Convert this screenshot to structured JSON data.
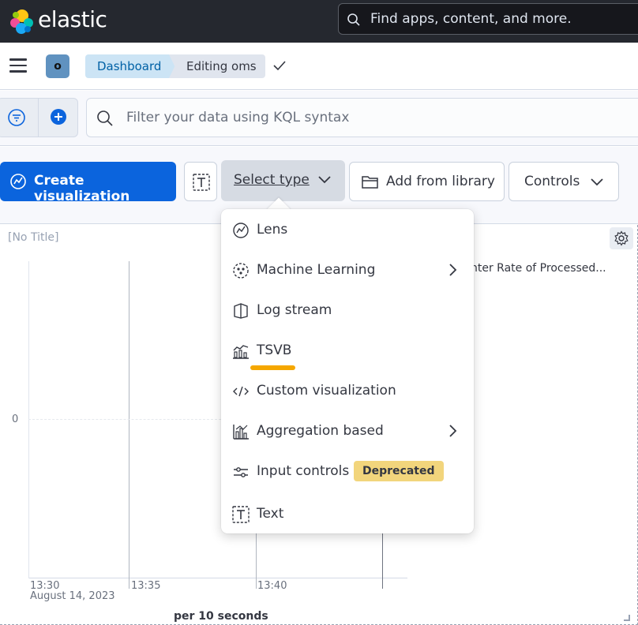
{
  "header": {
    "brand": "elastic",
    "search_placeholder": "Find apps, content, and more."
  },
  "breadcrumbs": {
    "space_initial": "o",
    "items": [
      "Dashboard",
      "Editing oms"
    ]
  },
  "query_bar": {
    "placeholder": "Filter your data using KQL syntax"
  },
  "toolbar": {
    "create_label": "Create visualization",
    "select_type_label": "Select type",
    "library_label": "Add from library",
    "controls_label": "Controls"
  },
  "panel": {
    "title": "[No Title]",
    "legend": "nter Rate of Processed...",
    "y_zero": "0",
    "x_ticks": [
      "13:30",
      "13:35",
      "13:40"
    ],
    "x_date": "August 14, 2023",
    "x_axis_title": "per 10 seconds"
  },
  "menu": {
    "items": [
      {
        "label": "Lens",
        "icon": "lens-icon"
      },
      {
        "label": "Machine Learning",
        "icon": "machine-learning-icon"
      },
      {
        "label": "Log stream",
        "icon": "log-stream-icon"
      },
      {
        "label": "TSVB",
        "icon": "tsvb-icon"
      },
      {
        "label": "Custom visualization",
        "icon": "code-icon"
      },
      {
        "label": "Aggregation based",
        "icon": "aggregation-icon"
      },
      {
        "label": "Input controls",
        "icon": "input-controls-icon"
      },
      {
        "label": "Text",
        "icon": "text-icon"
      }
    ],
    "badge": "Deprecated"
  },
  "colors": {
    "header_bg": "#25282f",
    "primary": "#0b64dd",
    "badge": "#f2d57c",
    "highlight": "#f5a700"
  }
}
